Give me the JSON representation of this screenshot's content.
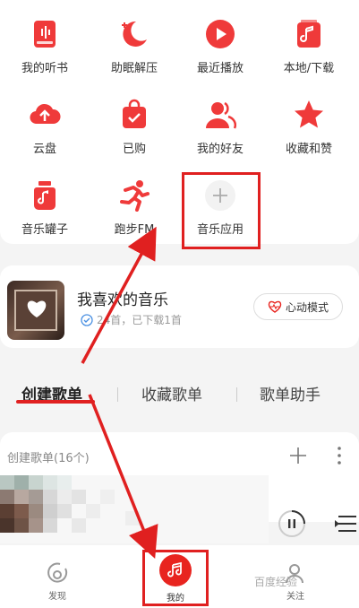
{
  "grid": {
    "items": [
      {
        "label": "我的听书",
        "icon": "audiobook-icon"
      },
      {
        "label": "助眠解压",
        "icon": "moon-icon"
      },
      {
        "label": "最近播放",
        "icon": "play-circle-icon"
      },
      {
        "label": "本地/下载",
        "icon": "music-file-icon"
      },
      {
        "label": "云盘",
        "icon": "cloud-upload-icon"
      },
      {
        "label": "已购",
        "icon": "shopping-bag-icon"
      },
      {
        "label": "我的好友",
        "icon": "friends-icon"
      },
      {
        "label": "收藏和赞",
        "icon": "star-icon"
      },
      {
        "label": "音乐罐子",
        "icon": "music-jar-icon"
      },
      {
        "label": "跑步FM",
        "icon": "running-icon"
      },
      {
        "label": "音乐应用",
        "icon": "plus-icon"
      }
    ]
  },
  "favorite": {
    "title": "我喜欢的音乐",
    "subtitle": "24首，已下载1首",
    "mode_button": "心动模式"
  },
  "tabs": [
    {
      "label": "创建歌单",
      "active": true
    },
    {
      "label": "收藏歌单",
      "active": false
    },
    {
      "label": "歌单助手",
      "active": false
    }
  ],
  "playlists": {
    "header": "创建歌单(16个)"
  },
  "bottom_nav": [
    {
      "label": "发现",
      "icon": "discover-icon",
      "active": false
    },
    {
      "label": "我的",
      "icon": "music-note-icon",
      "active": true
    },
    {
      "label": "关注",
      "icon": "follow-icon",
      "active": false
    }
  ],
  "watermark": "百度经验",
  "colors": {
    "accent": "#e8241f",
    "annotation": "#e02020"
  }
}
